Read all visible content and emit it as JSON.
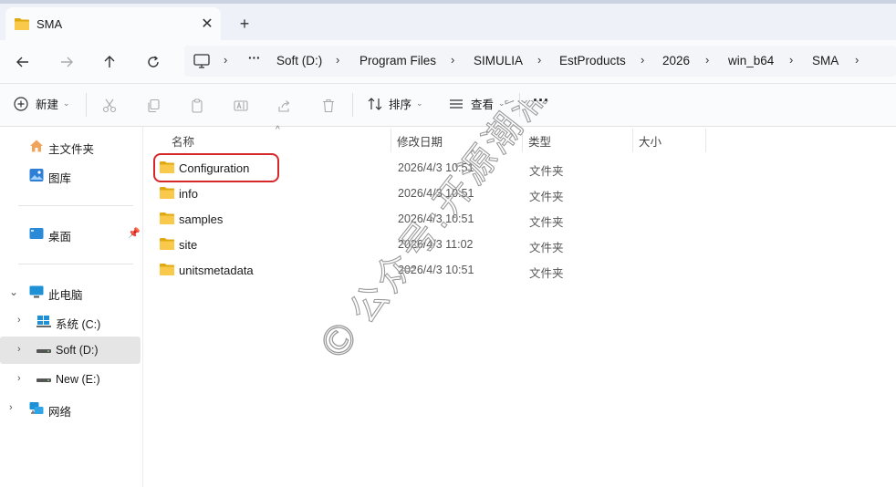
{
  "tab": {
    "title": "SMA",
    "close_glyph": "✕",
    "new_tab_glyph": "+",
    "icon": "folder-icon"
  },
  "nav": {
    "back_icon": "arrow-left-icon",
    "forward_icon": "arrow-right-icon",
    "up_icon": "arrow-up-icon",
    "refresh_icon": "refresh-icon",
    "more_glyph": "···",
    "breadcrumb": [
      "Soft (D:)",
      "Program Files",
      "SIMULIA",
      "EstProducts",
      "2026",
      "win_b64",
      "SMA"
    ]
  },
  "toolbar": {
    "new_label": "新建",
    "sort_label": "排序",
    "view_label": "查看",
    "more_glyph": "···"
  },
  "sidebar": {
    "home": "主文件夹",
    "gallery": "图库",
    "desktop": "桌面",
    "this_pc": "此电脑",
    "drive_c": "系统 (C:)",
    "drive_d": "Soft (D:)",
    "drive_e": "New (E:)",
    "network": "网络"
  },
  "columns": {
    "name": "名称",
    "modified": "修改日期",
    "type": "类型",
    "size": "大小"
  },
  "files": [
    {
      "name": "Configuration",
      "modified": "2026/4/3 10:51",
      "type": "文件夹",
      "highlighted": true
    },
    {
      "name": "info",
      "modified": "2026/4/3 10:51",
      "type": "文件夹"
    },
    {
      "name": "samples",
      "modified": "2026/4/3 10:51",
      "type": "文件夹"
    },
    {
      "name": "site",
      "modified": "2026/4/3 11:02",
      "type": "文件夹"
    },
    {
      "name": "unitsmetadata",
      "modified": "2026/4/3 10:51",
      "type": "文件夹"
    }
  ],
  "watermark": {
    "text": "公众号:开源潮涌器",
    "symbol": "©"
  },
  "colors": {
    "folder": "#f4c430",
    "folder_dark": "#e0a910",
    "highlight": "#d62828",
    "accent": "#0067c0"
  }
}
